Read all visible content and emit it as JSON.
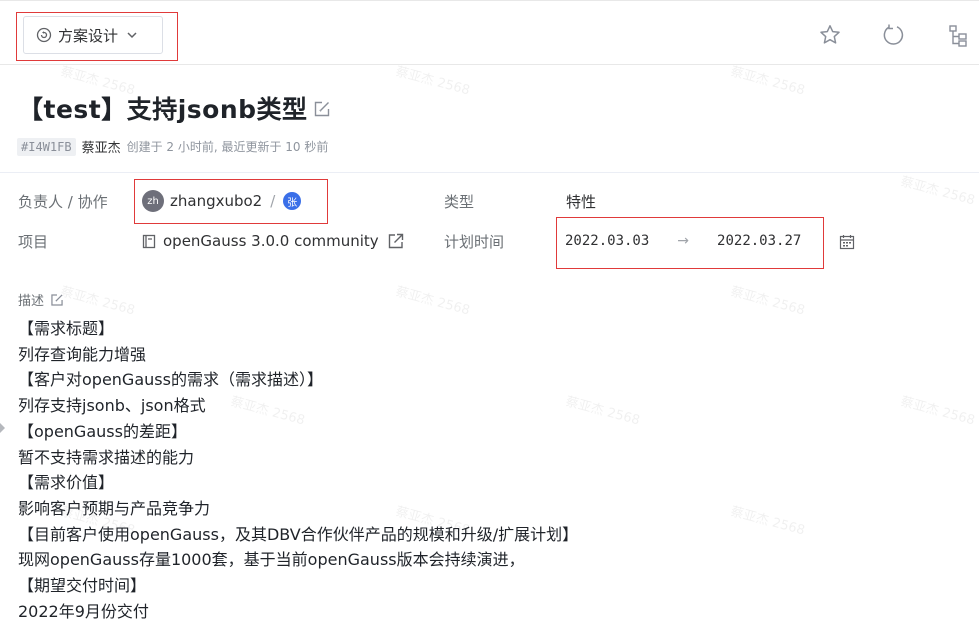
{
  "header": {
    "status_label": "方案设计",
    "icons": [
      "star-icon",
      "refresh-icon",
      "tree-icon"
    ]
  },
  "issue": {
    "title": "【test】支持jsonb类型",
    "id": "#I4W1FB",
    "author": "蔡亚杰",
    "timeline": "创建于 2 小时前, 最近更新于 10 秒前"
  },
  "fields": {
    "assignee_label": "负责人 / 协作",
    "assignee_avatar": "zh",
    "assignee_name": "zhangxubo2",
    "assignee_sep": "/",
    "collaborator_avatar": "张",
    "type_label": "类型",
    "type_value": "特性",
    "project_label": "项目",
    "project_value": "openGauss 3.0.0 community",
    "plan_label": "计划时间",
    "start_date": "2022.03.03",
    "arrow": "→",
    "end_date": "2022.03.27"
  },
  "description": {
    "label": "描述",
    "lines": [
      "【需求标题】",
      "列存查询能力增强",
      "【客户对openGauss的需求（需求描述）】",
      "列存支持jsonb、json格式",
      "【openGauss的差距】",
      "暂不支持需求描述的能力",
      "【需求价值】",
      "影响客户预期与产品竞争力",
      "【目前客户使用openGauss，及其DBV合作伙伴产品的规模和升级/扩展计划】",
      "现网openGauss存量1000套，基于当前openGauss版本会持续演进，",
      "【期望交付时间】",
      "2022年9月份交付"
    ]
  },
  "watermark": "蔡亚杰 2568",
  "colors": {
    "annotation_box": "#e03a3a",
    "avatar_blue": "#3a6fe8"
  }
}
